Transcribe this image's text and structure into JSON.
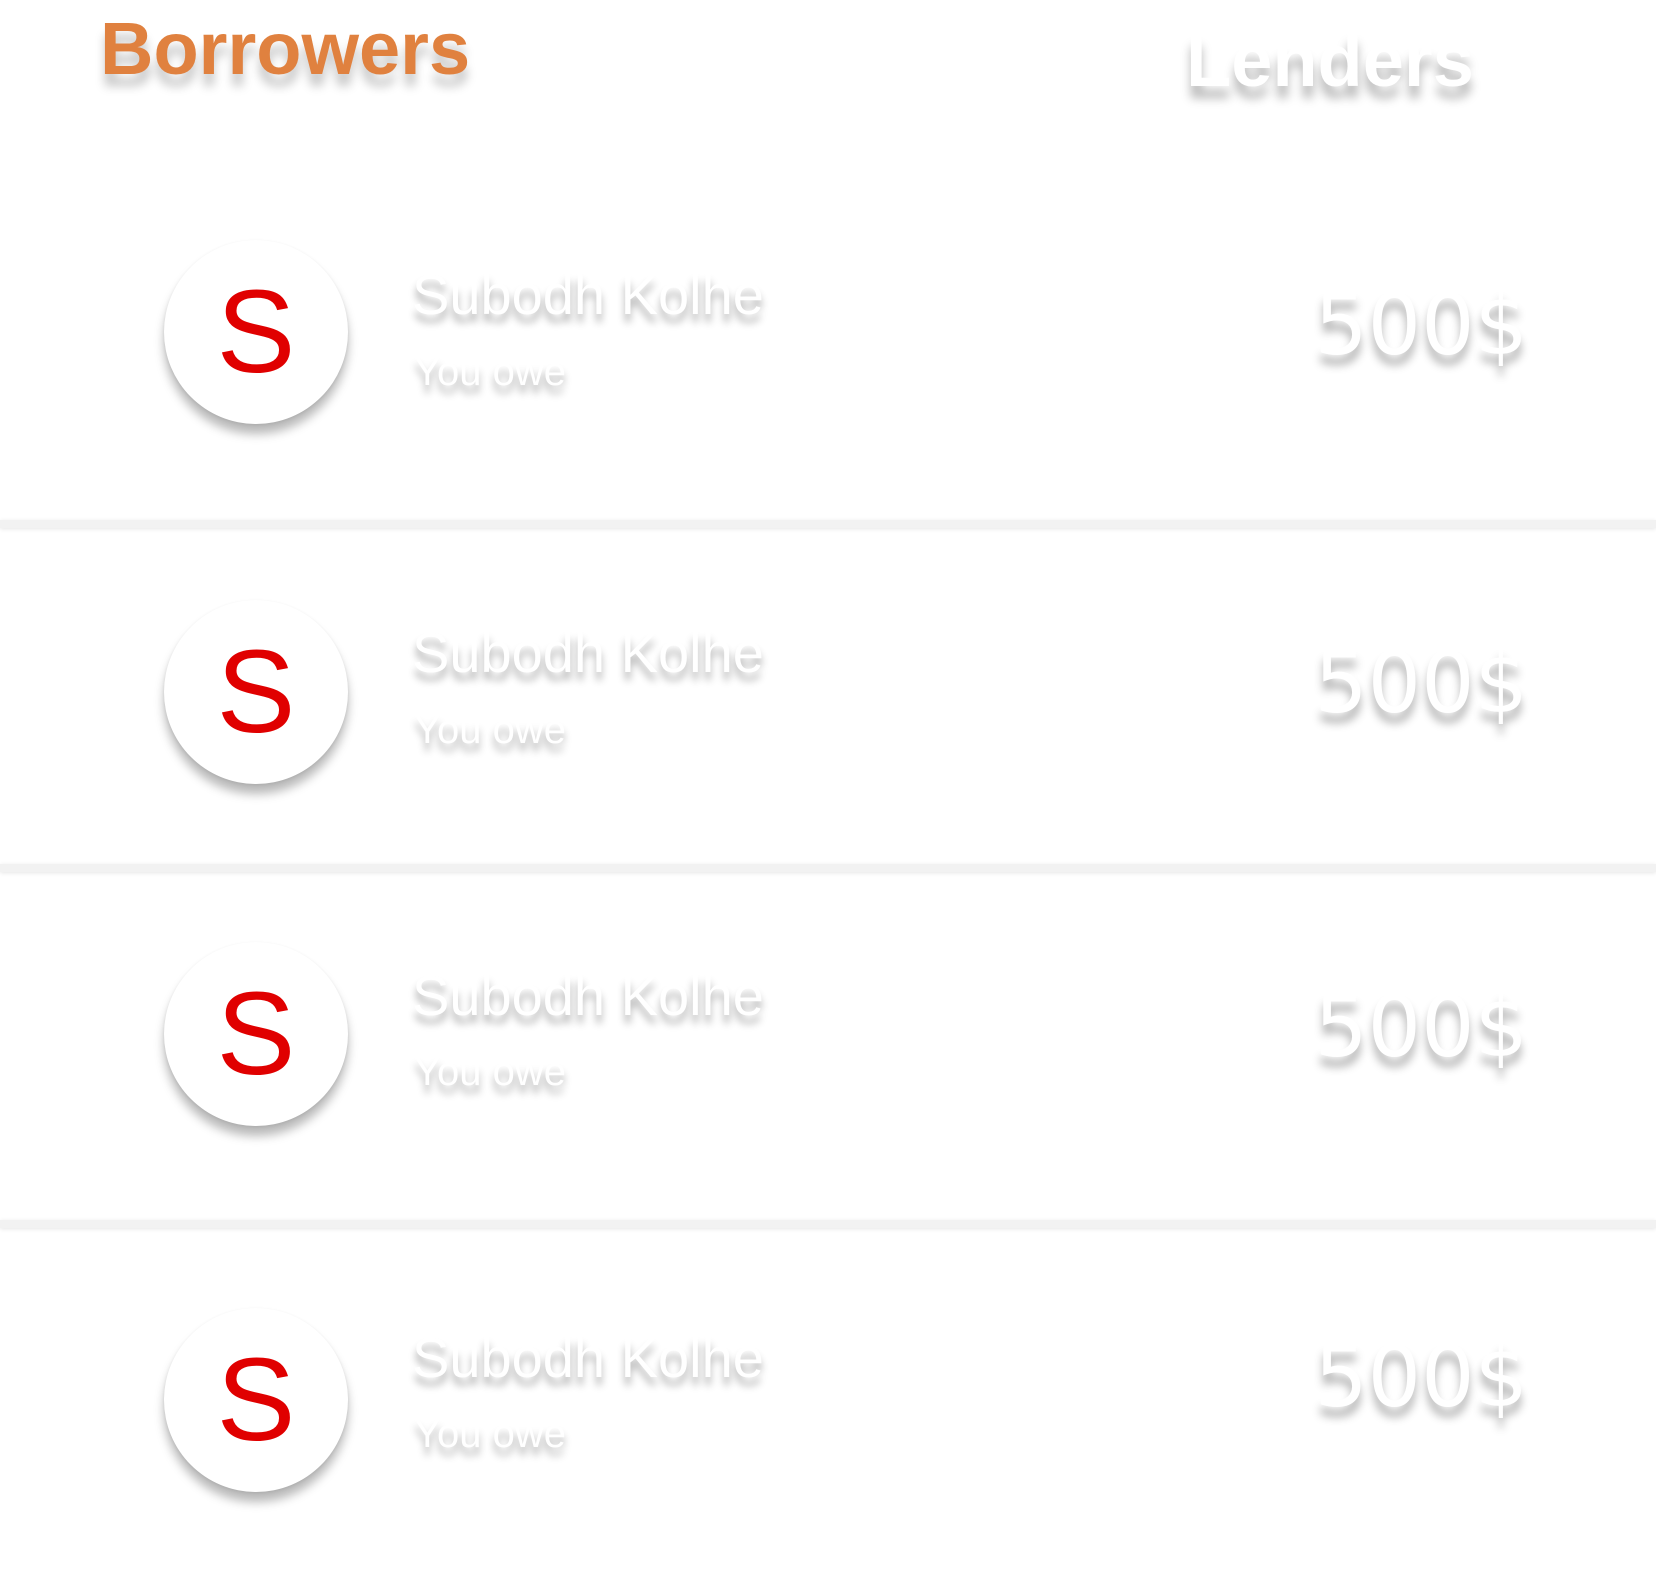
{
  "tabs": {
    "borrowers_label": "Borrowers",
    "lenders_label": "Lenders",
    "active_tab": "Borrowers",
    "active_color": "#e0813f"
  },
  "rows": [
    {
      "avatar_letter": "S",
      "name": "Subodh Kolhe",
      "subtitle": "You owe",
      "amount": "500$"
    },
    {
      "avatar_letter": "S",
      "name": "Subodh Kolhe",
      "subtitle": "You owe",
      "amount": "500$"
    },
    {
      "avatar_letter": "S",
      "name": "Subodh Kolhe",
      "subtitle": "You owe",
      "amount": "500$"
    },
    {
      "avatar_letter": "S",
      "name": "Subodh Kolhe",
      "subtitle": "You owe",
      "amount": "500$"
    }
  ],
  "colors": {
    "avatar_letter": "#e00000",
    "background": "#ffffff"
  }
}
